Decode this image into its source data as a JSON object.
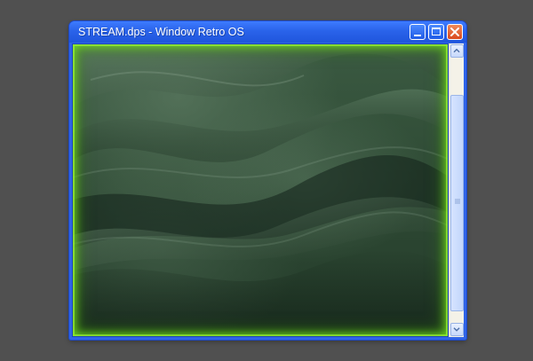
{
  "window": {
    "title": "STREAM.dps - Window Retro OS"
  },
  "icons": {
    "minimize": "minimize-icon",
    "maximize": "maximize-icon",
    "close": "close-icon",
    "scroll_up": "chevron-up-icon",
    "scroll_down": "chevron-down-icon",
    "scroll_grip": "grip-lines-icon"
  },
  "colors": {
    "titlebar": "#2a63ea",
    "close_button": "#d9481e",
    "glow": "#78e61e",
    "wallpaper": "#2f4b35",
    "desktop": "#505050"
  }
}
